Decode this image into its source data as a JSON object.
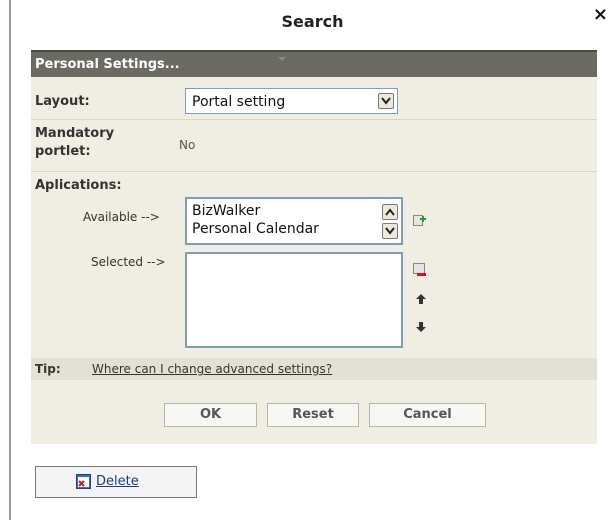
{
  "dialog": {
    "title": "Search",
    "close": "×"
  },
  "panel": {
    "header": "Personal Settings...",
    "layout_label": "Layout:",
    "layout_value": "Portal setting",
    "mandatory_label_line1": "Mandatory",
    "mandatory_label_line2": "portlet:",
    "mandatory_value": "No",
    "applications_label": "Aplications:",
    "available_label": "Available -->",
    "available_options": [
      "BizWalker",
      "Personal Calendar"
    ],
    "selected_label": "Selected -->",
    "selected_options": [],
    "tip_label": "Tip:",
    "tip_link": "Where can I change advanced settings?"
  },
  "buttons": {
    "ok": "OK",
    "reset": "Reset",
    "cancel": "Cancel",
    "delete": "Delete"
  },
  "icons": [
    "close-icon",
    "chevron-down-icon",
    "scroll-up-icon",
    "scroll-down-icon",
    "add-icon",
    "remove-icon",
    "move-up-icon",
    "move-down-icon",
    "delete-icon"
  ]
}
